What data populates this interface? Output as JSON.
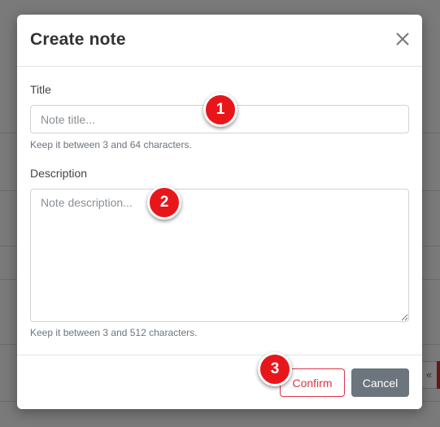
{
  "modal": {
    "title": "Create note",
    "close_icon": "close-icon"
  },
  "form": {
    "title_label": "Title",
    "title_placeholder": "Note title...",
    "title_help": "Keep it between 3 and 64 characters.",
    "description_label": "Description",
    "description_placeholder": "Note description...",
    "description_help": "Keep it between 3 and 512 characters."
  },
  "footer": {
    "confirm_label": "Confirm",
    "cancel_label": "Cancel"
  },
  "background": {
    "pager_symbol": "«"
  },
  "markers": [
    "1",
    "2",
    "3"
  ],
  "colors": {
    "marker": "#e8161b",
    "confirm": "#dc3545",
    "cancel": "#6c757d"
  }
}
